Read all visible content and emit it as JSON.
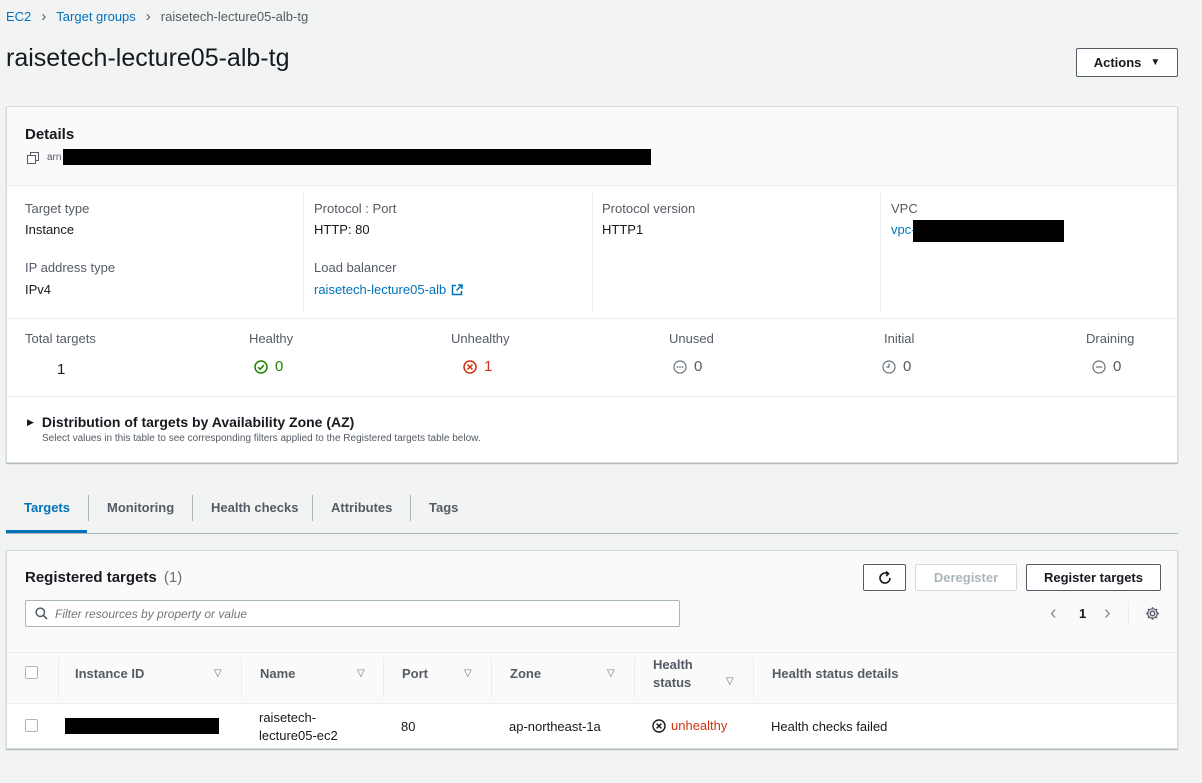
{
  "breadcrumb": {
    "items": [
      "EC2",
      "Target groups"
    ],
    "current": "raisetech-lecture05-alb-tg"
  },
  "page": {
    "title": "raisetech-lecture05-alb-tg",
    "actions_label": "Actions"
  },
  "details": {
    "heading": "Details",
    "arn_prefix": "arn",
    "fields": {
      "target_type": {
        "label": "Target type",
        "value": "Instance"
      },
      "protocol_port": {
        "label": "Protocol : Port",
        "value": "HTTP: 80"
      },
      "protocol_version": {
        "label": "Protocol version",
        "value": "HTTP1"
      },
      "vpc": {
        "label": "VPC",
        "value": "vpc-"
      },
      "ip_address_type": {
        "label": "IP address type",
        "value": "IPv4"
      },
      "load_balancer": {
        "label": "Load balancer",
        "value": "raisetech-lecture05-alb"
      }
    },
    "stats": {
      "total": {
        "label": "Total targets",
        "value": "1"
      },
      "healthy": {
        "label": "Healthy",
        "value": "0"
      },
      "unhealthy": {
        "label": "Unhealthy",
        "value": "1"
      },
      "unused": {
        "label": "Unused",
        "value": "0"
      },
      "initial": {
        "label": "Initial",
        "value": "0"
      },
      "draining": {
        "label": "Draining",
        "value": "0"
      }
    },
    "distribution": {
      "title": "Distribution of targets by Availability Zone (AZ)",
      "subtitle": "Select values in this table to see corresponding filters applied to the Registered targets table below."
    }
  },
  "tabs": [
    "Targets",
    "Monitoring",
    "Health checks",
    "Attributes",
    "Tags"
  ],
  "registered": {
    "title": "Registered targets",
    "count": "(1)",
    "deregister_label": "Deregister",
    "register_label": "Register targets",
    "search_placeholder": "Filter resources by property or value",
    "page_number": "1",
    "columns": {
      "instance_id": "Instance ID",
      "name": "Name",
      "port": "Port",
      "zone": "Zone",
      "health_status": "Health status",
      "health_status_details": "Health status details"
    },
    "row": {
      "name_line1": "raisetech-",
      "name_line2": "lecture05-ec2",
      "port": "80",
      "zone": "ap-northeast-1a",
      "health_status": "unhealthy",
      "health_details": "Health checks failed"
    }
  },
  "colors": {
    "link": "#0073bb",
    "healthy": "#1d8102",
    "unhealthy": "#d13212",
    "neutral": "#687078"
  }
}
